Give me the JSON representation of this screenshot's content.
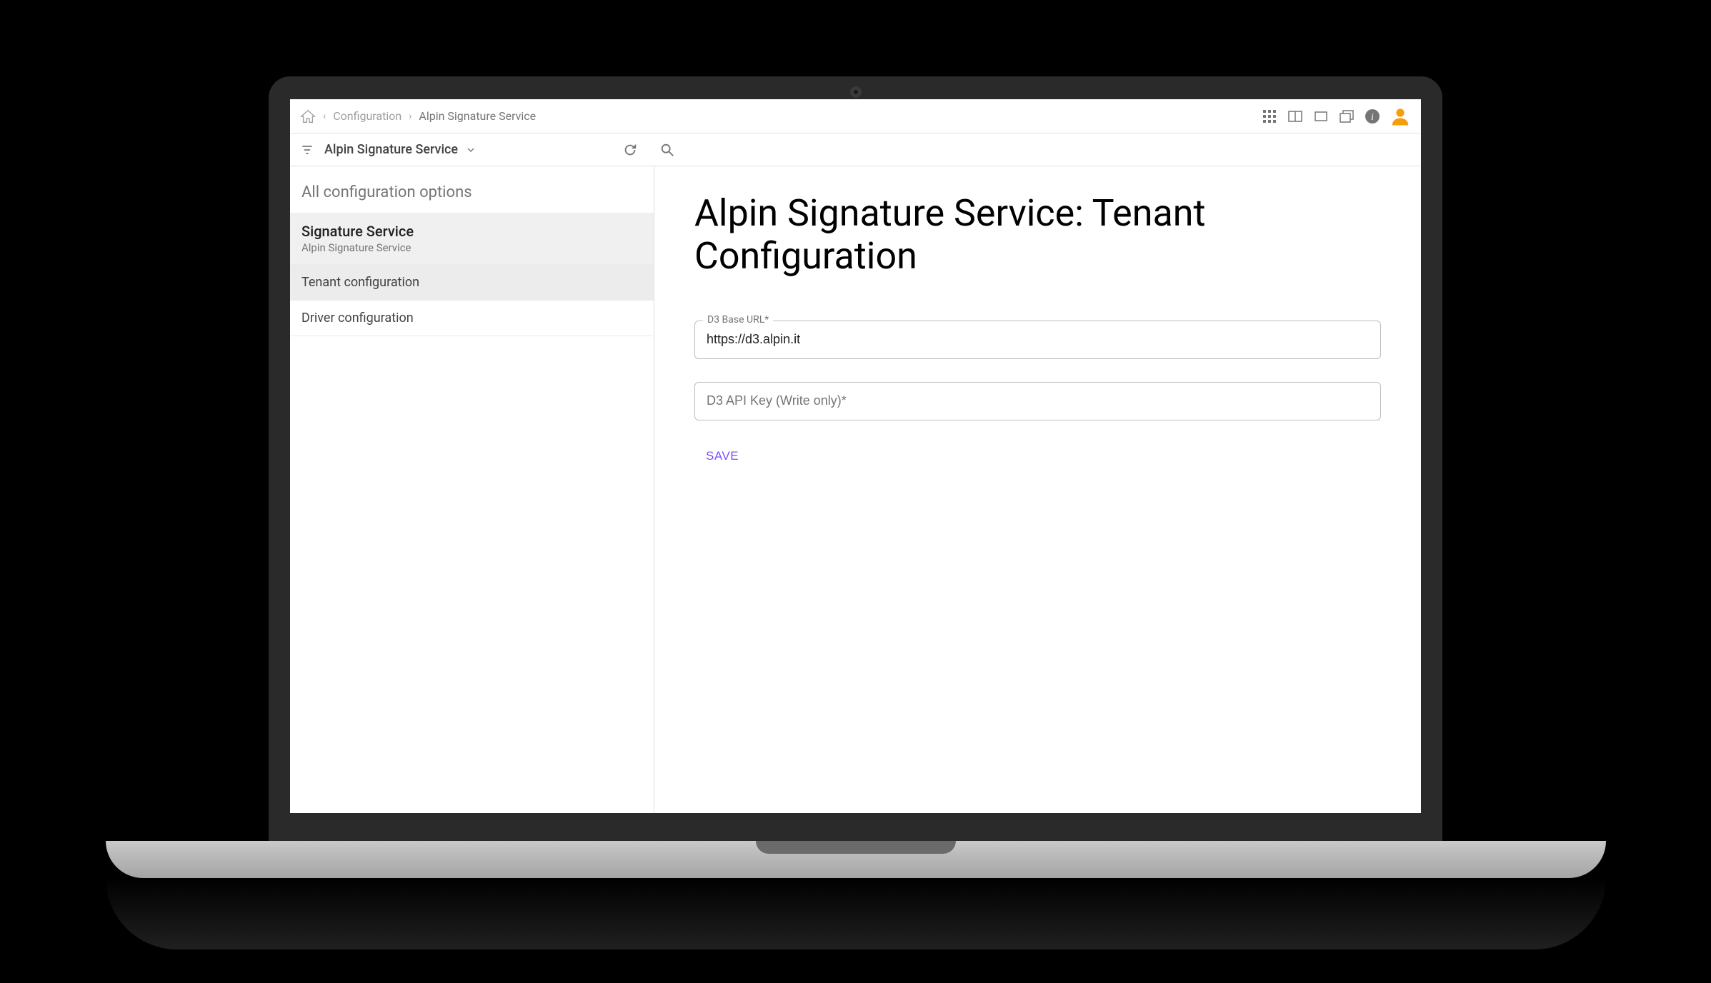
{
  "breadcrumbs": {
    "configuration": "Configuration",
    "current": "Alpin Signature Service"
  },
  "subheader": {
    "filter_label": "Alpin Signature Service"
  },
  "sidebar": {
    "heading": "All configuration options",
    "group": {
      "title": "Signature Service",
      "subtitle": "Alpin Signature Service"
    },
    "items": [
      {
        "label": "Tenant configuration"
      },
      {
        "label": "Driver configuration"
      }
    ]
  },
  "content": {
    "title": "Alpin Signature Service: Tenant Configuration",
    "field_base_url": {
      "label": "D3 Base URL*",
      "value": "https://d3.alpin.it"
    },
    "field_api_key": {
      "placeholder": "D3 API Key (Write only)*"
    },
    "save_label": "SAVE"
  }
}
